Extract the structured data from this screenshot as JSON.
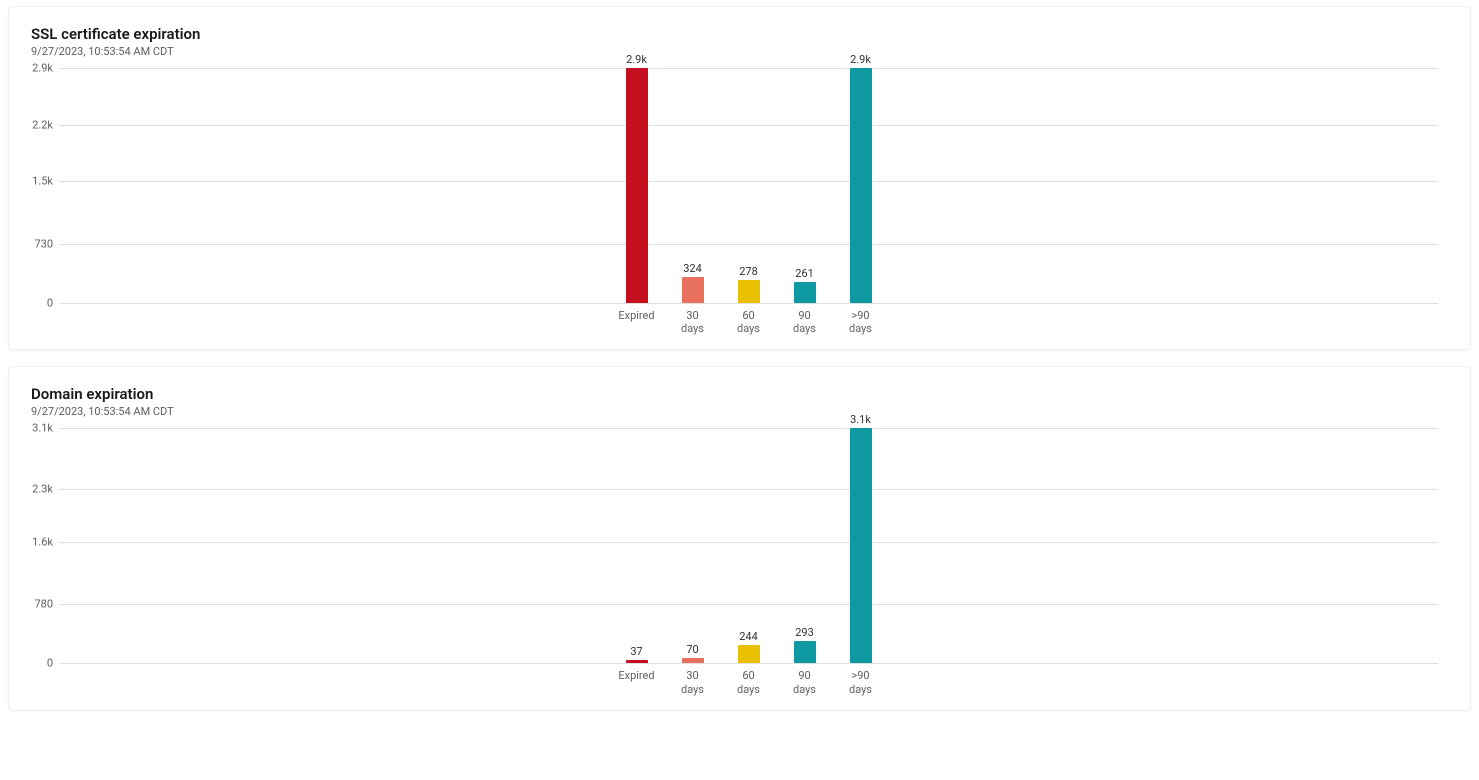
{
  "cards": [
    {
      "title": "SSL certificate expiration",
      "timestamp": "9/27/2023, 10:53:54 AM CDT"
    },
    {
      "title": "Domain expiration",
      "timestamp": "9/27/2023, 10:53:54 AM CDT"
    }
  ],
  "chart_data": [
    {
      "type": "bar",
      "title": "SSL certificate expiration",
      "xlabel": "",
      "ylabel": "",
      "ylim": [
        0,
        2900
      ],
      "y_ticks": [
        0,
        730,
        1500,
        2200,
        2900
      ],
      "y_tick_labels": [
        "0",
        "730",
        "1.5k",
        "2.2k",
        "2.9k"
      ],
      "categories": [
        "Expired",
        "30\ndays",
        "60\ndays",
        "90\ndays",
        ">90\ndays"
      ],
      "values": [
        2900,
        324,
        278,
        261,
        2900
      ],
      "value_labels": [
        "2.9k",
        "324",
        "278",
        "261",
        "2.9k"
      ],
      "colors": [
        "#c50f1f",
        "#e8715d",
        "#eac100",
        "#0f9aa3",
        "#0f9aa3"
      ]
    },
    {
      "type": "bar",
      "title": "Domain expiration",
      "xlabel": "",
      "ylabel": "",
      "ylim": [
        0,
        3100
      ],
      "y_ticks": [
        0,
        780,
        1600,
        2300,
        3100
      ],
      "y_tick_labels": [
        "0",
        "780",
        "1.6k",
        "2.3k",
        "3.1k"
      ],
      "categories": [
        "Expired",
        "30\ndays",
        "60\ndays",
        "90\ndays",
        ">90\ndays"
      ],
      "values": [
        37,
        70,
        244,
        293,
        3100
      ],
      "value_labels": [
        "37",
        "70",
        "244",
        "293",
        "3.1k"
      ],
      "colors": [
        "#c50f1f",
        "#e8715d",
        "#eac100",
        "#0f9aa3",
        "#0f9aa3"
      ]
    }
  ]
}
